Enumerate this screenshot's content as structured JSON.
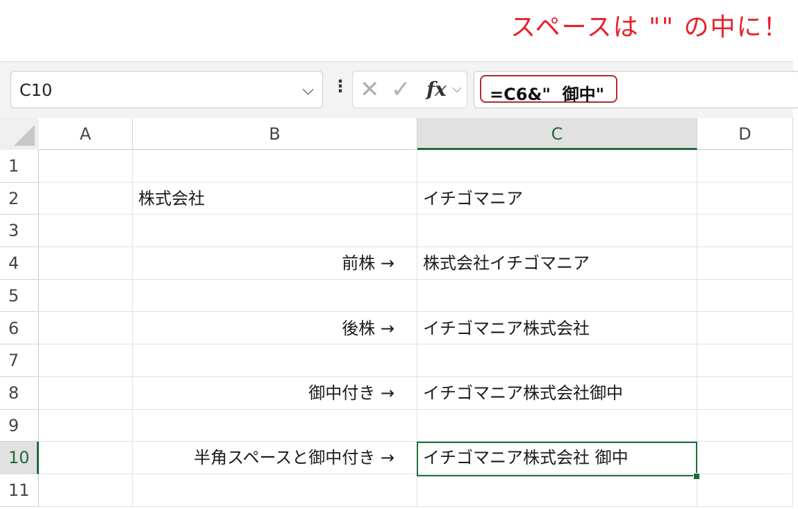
{
  "annotation": "スペースは \"\" の中に！",
  "namebox": {
    "value": "C10"
  },
  "formula_bar": {
    "formula": "=C6&\"  御中\"",
    "fx_label": "fx"
  },
  "columns": [
    "A",
    "B",
    "C",
    "D"
  ],
  "selected_column": "C",
  "selected_row": "10",
  "rows": [
    {
      "num": "1",
      "b": "",
      "c": ""
    },
    {
      "num": "2",
      "b": "株式会社",
      "c": "イチゴマニア",
      "b_align": "left"
    },
    {
      "num": "3",
      "b": "",
      "c": ""
    },
    {
      "num": "4",
      "b": "前株 →",
      "c": "株式会社イチゴマニア",
      "b_align": "right"
    },
    {
      "num": "5",
      "b": "",
      "c": ""
    },
    {
      "num": "6",
      "b": "後株 →",
      "c": "イチゴマニア株式会社",
      "b_align": "right"
    },
    {
      "num": "7",
      "b": "",
      "c": ""
    },
    {
      "num": "8",
      "b": "御中付き →",
      "c": "イチゴマニア株式会社御中",
      "b_align": "right"
    },
    {
      "num": "9",
      "b": "",
      "c": ""
    },
    {
      "num": "10",
      "b": "半角スペースと御中付き →",
      "c": "イチゴマニア株式会社 御中",
      "b_align": "right"
    },
    {
      "num": "11",
      "b": "",
      "c": ""
    }
  ],
  "colors": {
    "accent": "#1d6b3a",
    "annotation": "#e8202a",
    "highlight": "#b02a30"
  }
}
